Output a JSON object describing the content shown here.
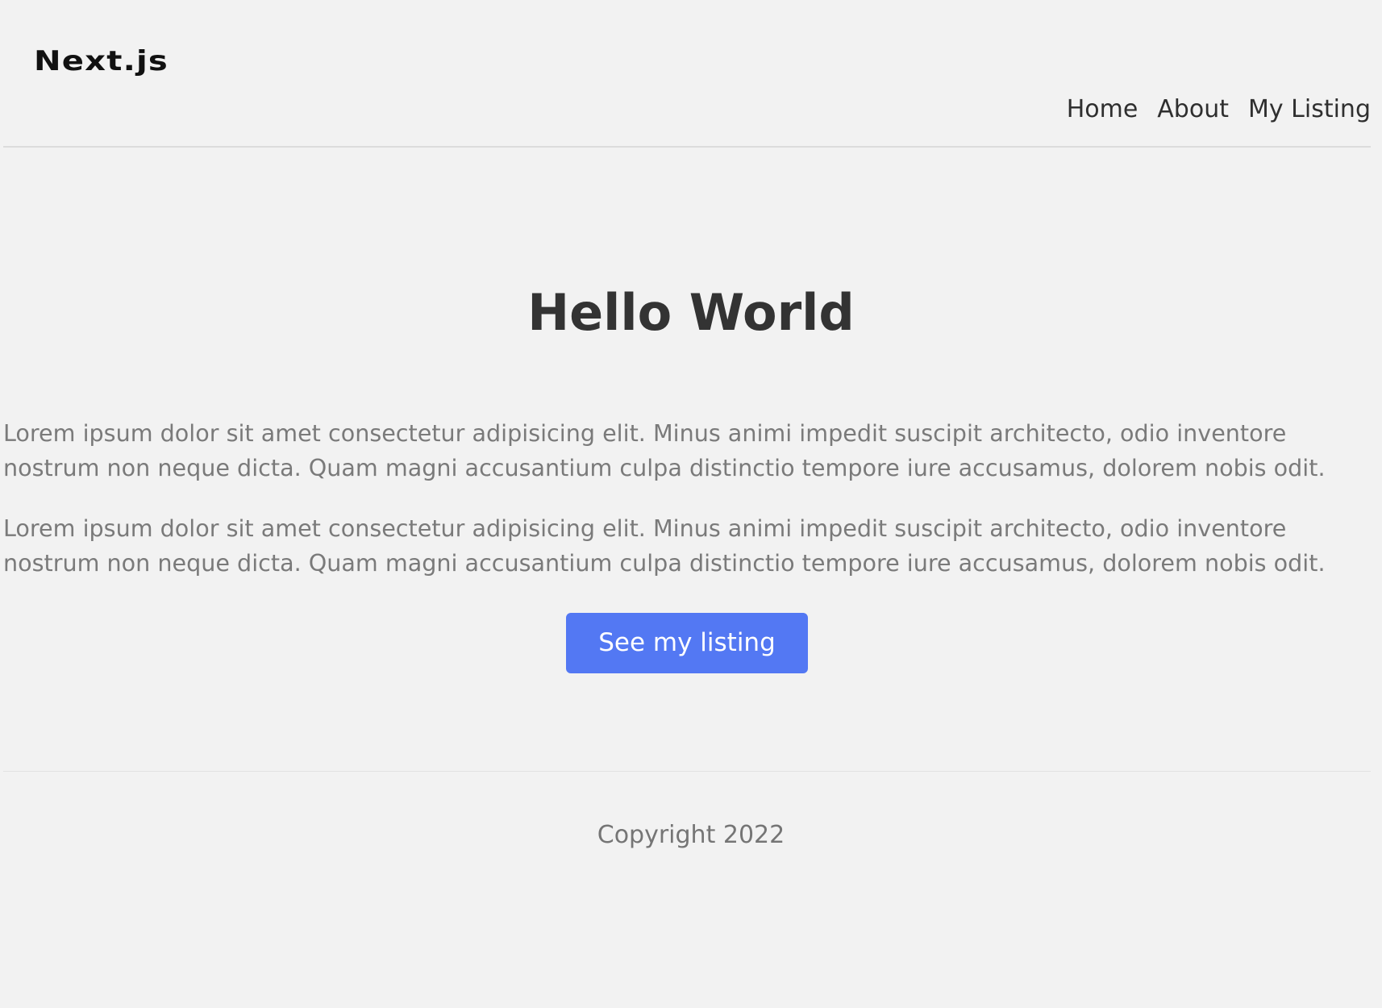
{
  "header": {
    "logo_text": "Next.js",
    "nav": [
      {
        "label": "Home"
      },
      {
        "label": "About"
      },
      {
        "label": "My Listing"
      }
    ]
  },
  "main": {
    "title": "Hello World",
    "paragraphs": [
      "Lorem ipsum dolor sit amet consectetur adipisicing elit. Minus animi impedit suscipit architecto, odio inventore nostrum non neque dicta. Quam magni accusantium culpa distinctio tempore iure accusamus, dolorem nobis odit.",
      "Lorem ipsum dolor sit amet consectetur adipisicing elit. Minus animi impedit suscipit architecto, odio inventore nostrum non neque dicta. Quam magni accusantium culpa distinctio tempore iure accusamus, dolorem nobis odit."
    ],
    "cta_label": "See my listing"
  },
  "footer": {
    "copyright": "Copyright 2022"
  },
  "colors": {
    "background": "#f2f2f2",
    "accent": "#5378f3",
    "heading": "#333333",
    "body_text": "#7a7a7a"
  }
}
